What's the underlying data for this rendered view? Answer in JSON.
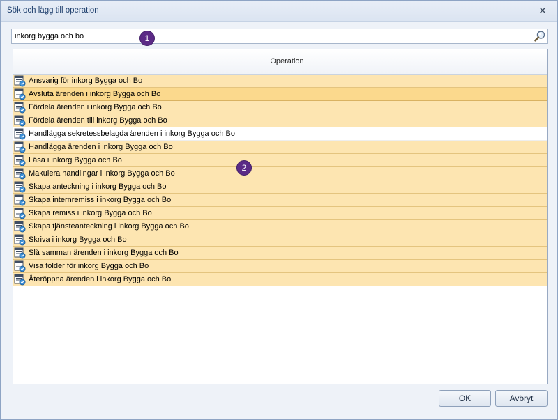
{
  "window": {
    "title": "Sök och lägg till operation",
    "close_glyph": "✕"
  },
  "search": {
    "value": "inkorg bygga och bo",
    "icon": "search-icon"
  },
  "badges": {
    "first": "1",
    "second": "2"
  },
  "grid": {
    "column_header": "Operation",
    "rows": [
      {
        "label": "Ansvarig för inkorg Bygga och Bo",
        "state": "highlighted"
      },
      {
        "label": "Avsluta ärenden i inkorg Bygga och Bo",
        "state": "selected"
      },
      {
        "label": "Fördela ärenden i inkorg Bygga och Bo",
        "state": "highlighted"
      },
      {
        "label": "Fördela ärenden till inkorg Bygga och Bo",
        "state": "highlighted"
      },
      {
        "label": "Handlägga sekretessbelagda ärenden i inkorg Bygga och Bo",
        "state": "plain"
      },
      {
        "label": "Handlägga ärenden i inkorg Bygga och Bo",
        "state": "highlighted"
      },
      {
        "label": "Läsa i inkorg Bygga och Bo",
        "state": "highlighted"
      },
      {
        "label": "Makulera handlingar i inkorg Bygga och Bo",
        "state": "highlighted"
      },
      {
        "label": "Skapa anteckning i inkorg Bygga och Bo",
        "state": "highlighted"
      },
      {
        "label": "Skapa internremiss i inkorg Bygga och Bo",
        "state": "highlighted"
      },
      {
        "label": "Skapa remiss i inkorg Bygga och Bo",
        "state": "highlighted"
      },
      {
        "label": "Skapa tjänsteanteckning i inkorg Bygga och Bo",
        "state": "highlighted"
      },
      {
        "label": "Skriva i inkorg Bygga och Bo",
        "state": "highlighted"
      },
      {
        "label": "Slå samman ärenden i inkorg Bygga och Bo",
        "state": "highlighted"
      },
      {
        "label": "Visa folder för inkorg Bygga och Bo",
        "state": "highlighted"
      },
      {
        "label": "Återöppna ärenden i inkorg Bygga och Bo",
        "state": "highlighted"
      }
    ]
  },
  "buttons": {
    "ok": "OK",
    "cancel": "Avbryt"
  },
  "colors": {
    "row_highlight": "#fde5b1",
    "row_selected": "#fbd98d",
    "badge": "#5b2a86",
    "title_text": "#1e3f6d"
  }
}
